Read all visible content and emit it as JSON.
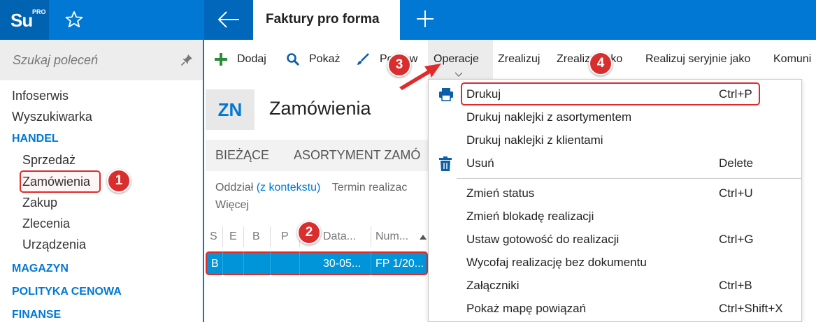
{
  "app": {
    "logo": "Su",
    "logo_sup": "PRO",
    "active_tab": "Faktury pro forma"
  },
  "sidebar": {
    "search_placeholder": "Szukaj poleceń",
    "items": [
      {
        "label": "Infoserwis",
        "type": "item"
      },
      {
        "label": "Wyszukiwarka",
        "type": "item"
      },
      {
        "label": "HANDEL",
        "type": "section"
      },
      {
        "label": "Sprzedaż",
        "type": "subitem"
      },
      {
        "label": "Zamówienia",
        "type": "subitem"
      },
      {
        "label": "Zakup",
        "type": "subitem"
      },
      {
        "label": "Zlecenia",
        "type": "subitem"
      },
      {
        "label": "Urządzenia",
        "type": "subitem"
      },
      {
        "label": "MAGAZYN",
        "type": "section"
      },
      {
        "label": "POLITYKA CENOWA",
        "type": "section"
      },
      {
        "label": "FINANSE",
        "type": "section"
      }
    ]
  },
  "toolbar": {
    "add": "Dodaj",
    "show": "Pokaż",
    "edit": "Popraw",
    "operations": "Operacje",
    "realize": "Zrealizuj",
    "realize_as": "Zrealizuj jako",
    "realize_series": "Realizuj seryjnie jako",
    "communication": "Komuni"
  },
  "page": {
    "badge": "ZN",
    "title": "Zamówienia",
    "tabs": [
      "BIEŻĄCE",
      "ASORTYMENT ZAMÓ"
    ],
    "filter_label": "Oddział",
    "filter_value": "(z kontekstu)",
    "filter_term": "Termin realizac",
    "more": "Więcej"
  },
  "table": {
    "columns": [
      "S",
      "E",
      "B",
      "P",
      "Data...",
      "Num..."
    ],
    "rows": [
      [
        "B",
        "",
        "",
        "",
        "30-05...",
        "FP 1/20..."
      ]
    ]
  },
  "dropdown": {
    "items": [
      {
        "label": "Drukuj",
        "shortcut": "Ctrl+P",
        "icon": "printer-icon"
      },
      {
        "label": "Drukuj naklejki z asortymentem",
        "shortcut": ""
      },
      {
        "label": "Drukuj naklejki z klientami",
        "shortcut": ""
      },
      {
        "label": "Usuń",
        "shortcut": "Delete",
        "icon": "trash-icon"
      },
      {
        "label": "Zmień status",
        "shortcut": "Ctrl+U"
      },
      {
        "label": "Zmień blokadę realizacji",
        "shortcut": ""
      },
      {
        "label": "Ustaw gotowość do realizacji",
        "shortcut": "Ctrl+G"
      },
      {
        "label": "Wycofaj realizację bez dokumentu",
        "shortcut": ""
      },
      {
        "label": "Załączniki",
        "shortcut": "Ctrl+B"
      },
      {
        "label": "Pokaż mapę powiązań",
        "shortcut": "Ctrl+Shift+X"
      }
    ]
  },
  "badges": [
    "1",
    "2",
    "3",
    "4"
  ]
}
